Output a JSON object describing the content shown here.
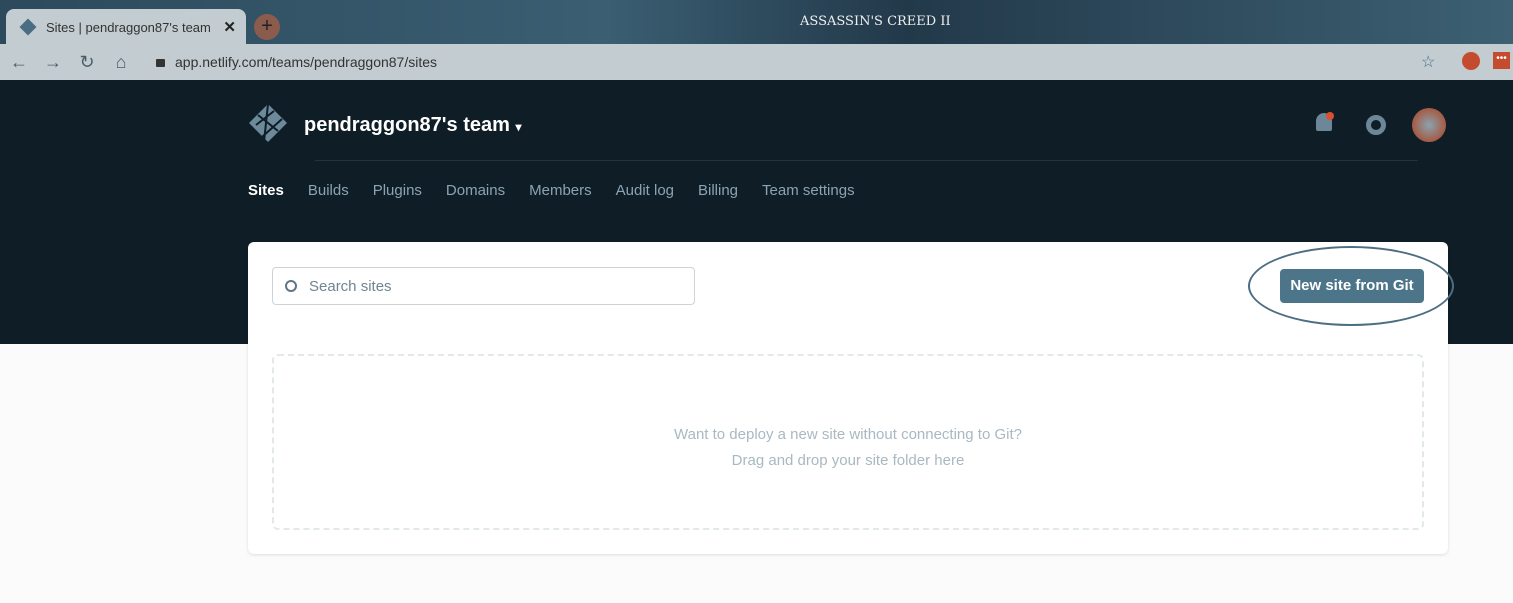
{
  "browser": {
    "tab_title": "Sites | pendraggon87's team",
    "url": "app.netlify.com/teams/pendraggon87/sites",
    "theme_logo": "ASSASSIN'S CREED II"
  },
  "header": {
    "team_name": "pendraggon87's team",
    "nav": [
      "Sites",
      "Builds",
      "Plugins",
      "Domains",
      "Members",
      "Audit log",
      "Billing",
      "Team settings"
    ],
    "active": "Sites"
  },
  "main": {
    "search_placeholder": "Search sites",
    "new_site_button": "New site from Git",
    "drop_line1": "Want to deploy a new site without connecting to Git?",
    "drop_line2": "Drag and drop your site folder here"
  },
  "colors": {
    "header_bg": "#0f1e26",
    "button": "#4c7589",
    "notification": "#d8502e"
  }
}
